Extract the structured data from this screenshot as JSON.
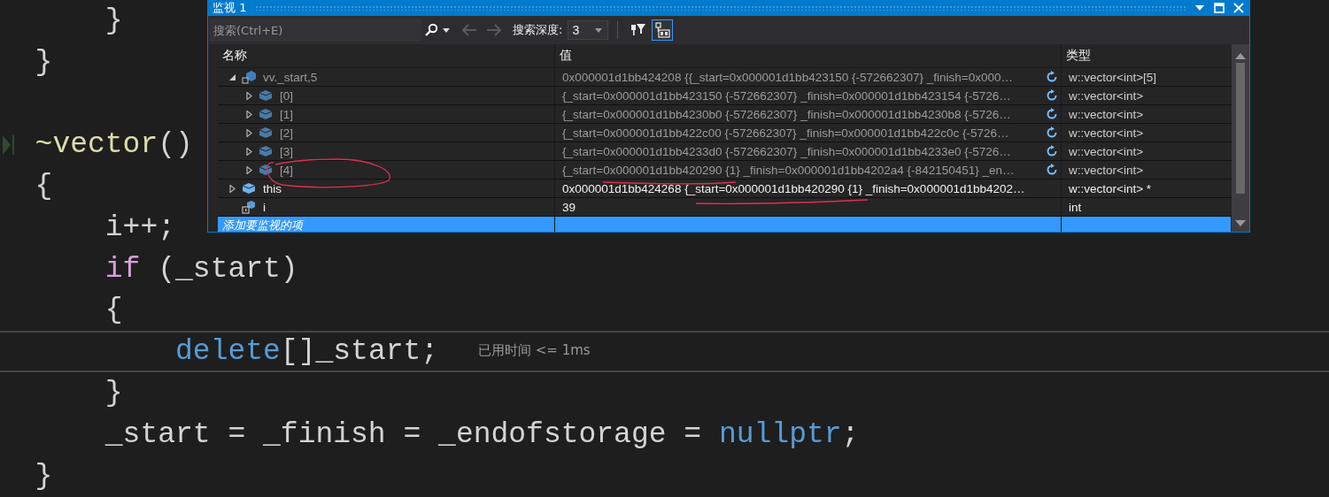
{
  "editor": {
    "lines": [
      {
        "current": false,
        "highlighted": false,
        "tokens": [
          {
            "text": "      }",
            "kind": "plain"
          }
        ]
      },
      {
        "current": false,
        "highlighted": false,
        "tokens": [
          {
            "text": "  }",
            "kind": "plain"
          }
        ]
      },
      {
        "current": true,
        "highlighted": false,
        "gap_before": true,
        "tokens": [
          {
            "text": "  ~vector",
            "kind": "function"
          },
          {
            "text": "()",
            "kind": "plain"
          }
        ]
      },
      {
        "current": false,
        "highlighted": false,
        "tokens": [
          {
            "text": "  {",
            "kind": "plain"
          }
        ]
      },
      {
        "current": false,
        "highlighted": false,
        "tokens": [
          {
            "text": "      i++;",
            "kind": "plain"
          }
        ]
      },
      {
        "current": false,
        "highlighted": false,
        "tokens": [
          {
            "text": "      if",
            "kind": "control"
          },
          {
            "text": " (_start)",
            "kind": "plain"
          }
        ]
      },
      {
        "current": false,
        "highlighted": false,
        "tokens": [
          {
            "text": "      {",
            "kind": "plain"
          }
        ]
      },
      {
        "current": false,
        "highlighted": true,
        "tokens": [
          {
            "text": "          delete",
            "kind": "keyword"
          },
          {
            "text": "[]_start;",
            "kind": "plain"
          }
        ],
        "hint": "已用时间 <= 1ms"
      },
      {
        "current": false,
        "highlighted": false,
        "tokens": [
          {
            "text": "      }",
            "kind": "plain"
          }
        ]
      },
      {
        "current": false,
        "highlighted": false,
        "tokens": [
          {
            "text": "      _start = _finish = _endofstorage = ",
            "kind": "plain"
          },
          {
            "text": "nullptr",
            "kind": "keyword"
          },
          {
            "text": ";",
            "kind": "plain"
          }
        ]
      },
      {
        "current": false,
        "highlighted": false,
        "tokens": [
          {
            "text": "  }",
            "kind": "plain"
          }
        ]
      }
    ]
  },
  "watch_window": {
    "title": "监视 1",
    "search": {
      "placeholder": "搜索(Ctrl+E)"
    },
    "depth_label": "搜索深度:",
    "depth_value": "3",
    "columns": [
      "名称",
      "值",
      "类型"
    ],
    "rows": [
      {
        "name": "vv._start,5",
        "value": "0x000001d1bb424208 {{_start=0x000001d1bb423150 {-572662307} _finish=0x000…",
        "type": "w::vector<int>[5]",
        "kind": "locked",
        "expanded": true,
        "stale": true,
        "children": [
          {
            "name": "[0]",
            "value": "{_start=0x000001d1bb423150 {-572662307} _finish=0x000001d1bb423154 {-5726…",
            "type": "w::vector<int>",
            "kind": "object",
            "expanded": false,
            "stale": true
          },
          {
            "name": "[1]",
            "value": "{_start=0x000001d1bb4230b0 {-572662307} _finish=0x000001d1bb4230b8 {-5726…",
            "type": "w::vector<int>",
            "kind": "object",
            "expanded": false,
            "stale": true
          },
          {
            "name": "[2]",
            "value": "{_start=0x000001d1bb422c00 {-572662307} _finish=0x000001d1bb422c0c {-5726…",
            "type": "w::vector<int>",
            "kind": "object",
            "expanded": false,
            "stale": true
          },
          {
            "name": "[3]",
            "value": "{_start=0x000001d1bb4233d0 {-572662307} _finish=0x000001d1bb4233e0 {-5726…",
            "type": "w::vector<int>",
            "kind": "object",
            "expanded": false,
            "stale": true
          },
          {
            "name": "[4]",
            "value": "{_start=0x000001d1bb420290 {1} _finish=0x000001d1bb4202a4 {-842150451} _en…",
            "type": "w::vector<int>",
            "kind": "object",
            "expanded": false,
            "stale": true
          }
        ]
      },
      {
        "name": "this",
        "value": "0x000001d1bb424268 {_start=0x000001d1bb420290 {1} _finish=0x000001d1bb4202…",
        "type": "w::vector<int> *",
        "kind": "object",
        "expanded": false,
        "stale": false
      },
      {
        "name": "i",
        "value": "39",
        "type": "int",
        "kind": "local",
        "stale": false
      }
    ],
    "add_row": {
      "placeholder": "添加要监视的项",
      "selected": true
    }
  }
}
